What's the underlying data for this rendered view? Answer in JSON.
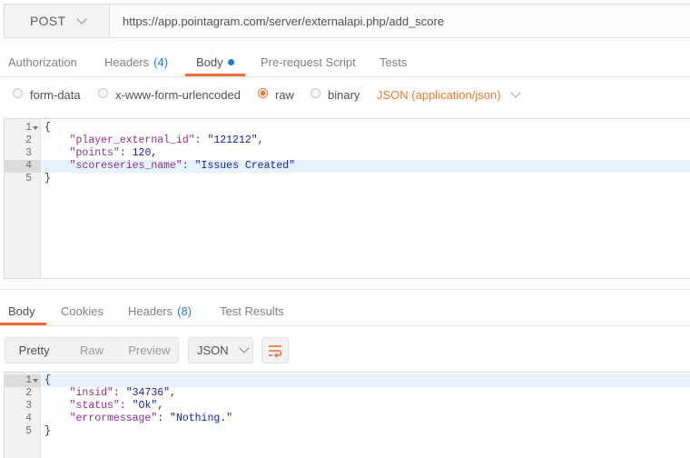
{
  "request": {
    "method": "POST",
    "url": "https://app.pointagram.com/server/externalapi.php/add_score"
  },
  "request_tabs": [
    {
      "label": "Authorization",
      "count": ""
    },
    {
      "label": "Headers",
      "count": "(4)"
    },
    {
      "label": "Body",
      "count": ""
    },
    {
      "label": "Pre-request Script",
      "count": ""
    },
    {
      "label": "Tests",
      "count": ""
    }
  ],
  "body_types": {
    "form_data": "form-data",
    "urlencoded": "x-www-form-urlencoded",
    "raw": "raw",
    "binary": "binary",
    "selected": "raw",
    "content_type": "JSON (application/json)"
  },
  "request_body": {
    "line_numbers": [
      "1",
      "2",
      "3",
      "4",
      "5"
    ],
    "open": "{",
    "close": "}",
    "fields": [
      {
        "key": "\"player_external_id\"",
        "value": "\"121212\"",
        "sep": ","
      },
      {
        "key": "\"points\"",
        "value": "120",
        "sep": ","
      },
      {
        "key": "\"scoreseries_name\"",
        "value": "\"Issues Created\"",
        "sep": ""
      }
    ]
  },
  "response_tabs": [
    {
      "label": "Body",
      "count": ""
    },
    {
      "label": "Cookies",
      "count": ""
    },
    {
      "label": "Headers",
      "count": "(8)"
    },
    {
      "label": "Test Results",
      "count": ""
    }
  ],
  "response_toolbar": {
    "modes": [
      "Pretty",
      "Raw",
      "Preview"
    ],
    "active_mode": "Pretty",
    "format": "JSON"
  },
  "response_body": {
    "line_numbers": [
      "1",
      "2",
      "3",
      "4",
      "5"
    ],
    "open": "{",
    "close": "}",
    "fields": [
      {
        "key": "\"insid\"",
        "value": "\"34736\"",
        "sep": ","
      },
      {
        "key": "\"status\"",
        "value": "\"Ok\"",
        "sep": ","
      },
      {
        "key": "\"errormessage\"",
        "value": "\"Nothing.\"",
        "sep": ""
      }
    ]
  },
  "colors": {
    "accent": "#f26b3a",
    "link": "#1e7ec8",
    "content_type": "#e2782f"
  }
}
